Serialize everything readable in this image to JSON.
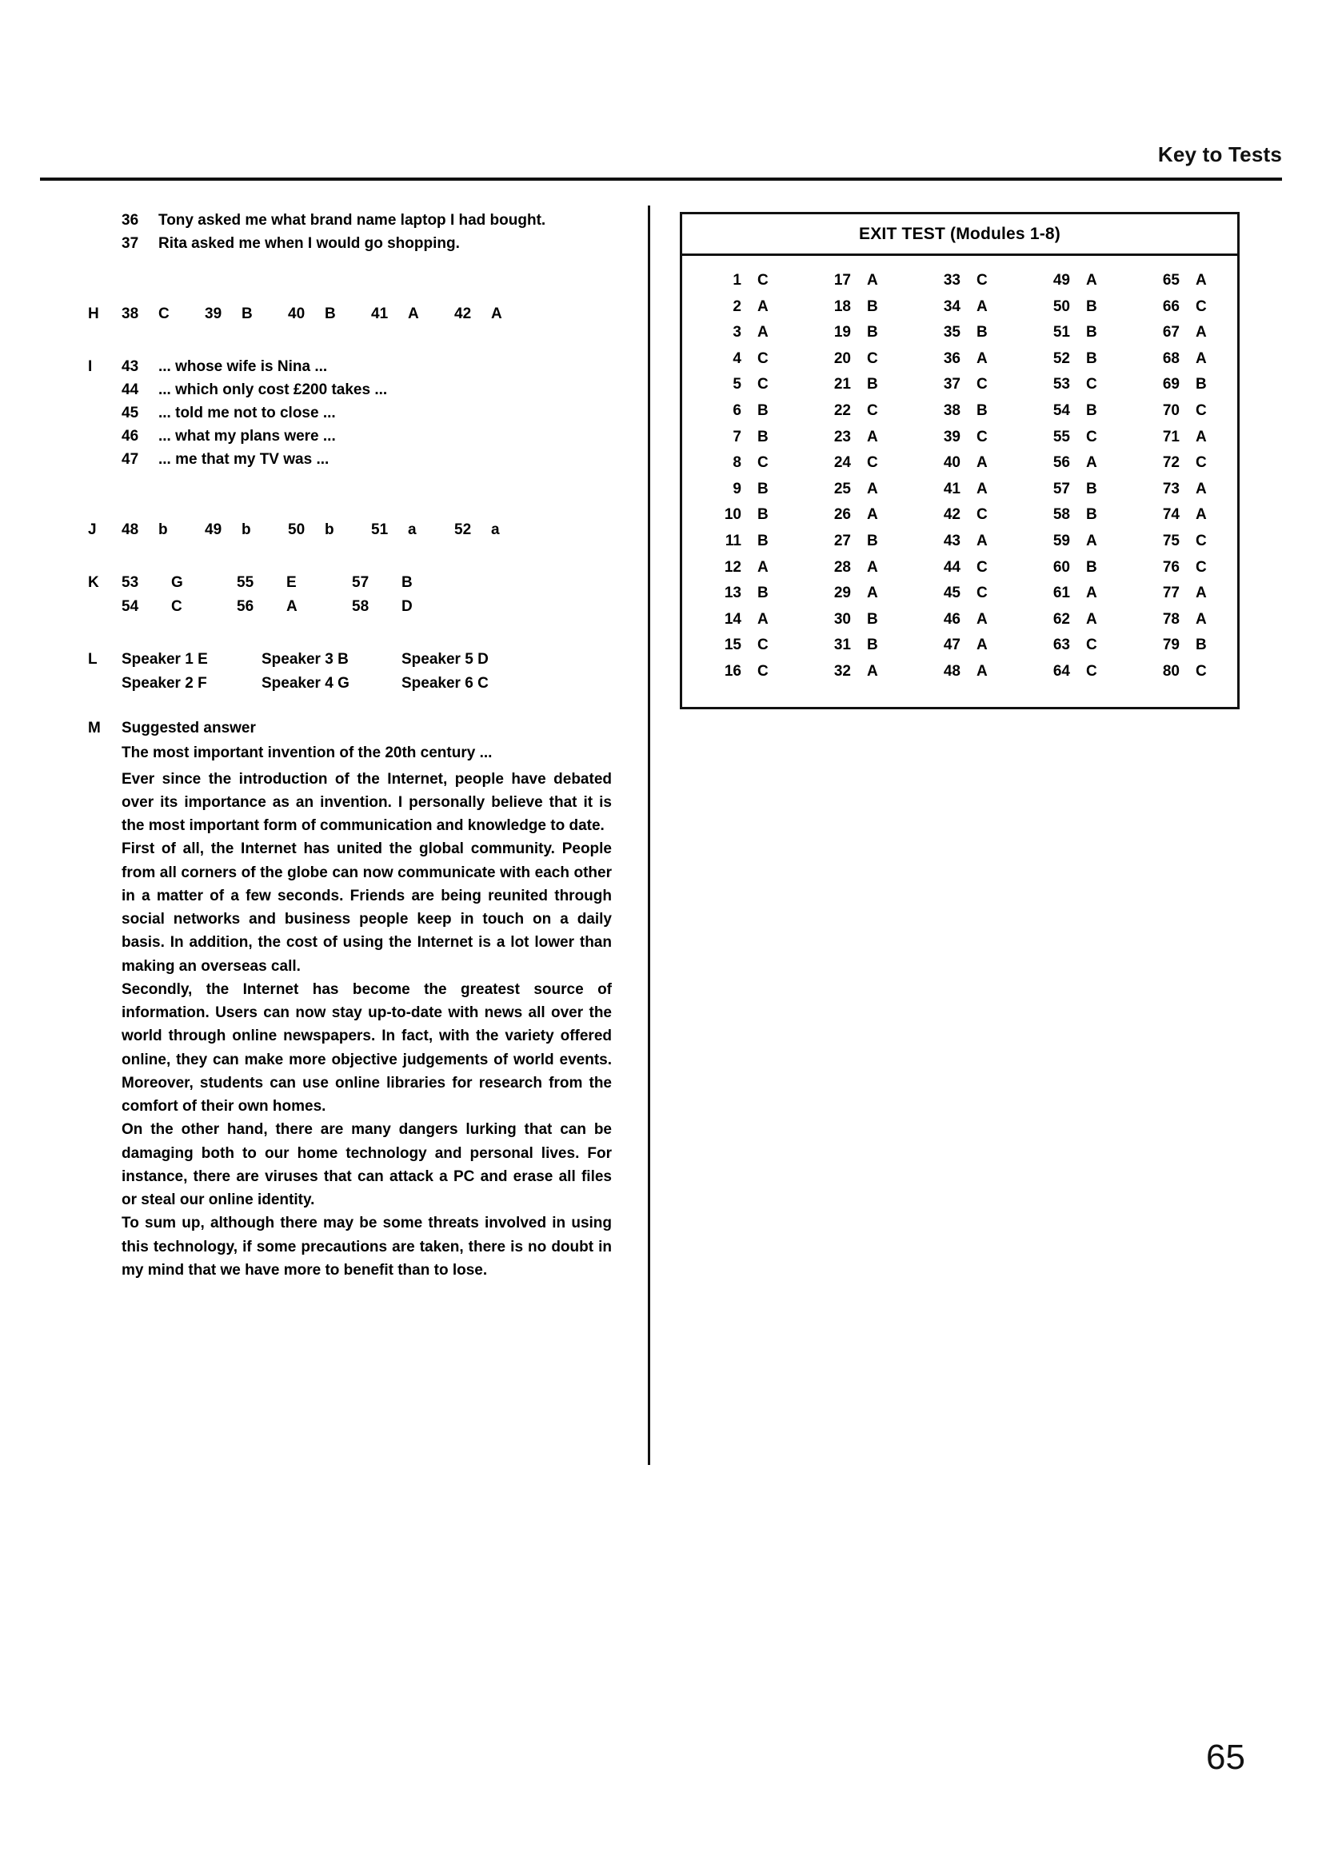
{
  "header": {
    "title": "Key to Tests"
  },
  "footer": {
    "page_number": "65"
  },
  "left_column": {
    "reported_speech": {
      "items": [
        {
          "num": "36",
          "text": "Tony asked me what brand name laptop I had bought."
        },
        {
          "num": "37",
          "text": "Rita asked me when I would go shopping."
        }
      ]
    },
    "section_h": {
      "letter": "H",
      "pairs": [
        {
          "q": "38",
          "a": "C"
        },
        {
          "q": "39",
          "a": "B"
        },
        {
          "q": "40",
          "a": "B"
        },
        {
          "q": "41",
          "a": "A"
        },
        {
          "q": "42",
          "a": "A"
        }
      ]
    },
    "section_i": {
      "letter": "I",
      "items": [
        {
          "num": "43",
          "text": "... whose wife is Nina ..."
        },
        {
          "num": "44",
          "text": "... which only cost £200 takes ..."
        },
        {
          "num": "45",
          "text": "... told me not to close ..."
        },
        {
          "num": "46",
          "text": "... what my plans were ..."
        },
        {
          "num": "47",
          "text": "... me that my TV was ..."
        }
      ]
    },
    "section_j": {
      "letter": "J",
      "pairs": [
        {
          "q": "48",
          "a": "b"
        },
        {
          "q": "49",
          "a": "b"
        },
        {
          "q": "50",
          "a": "b"
        },
        {
          "q": "51",
          "a": "a"
        },
        {
          "q": "52",
          "a": "a"
        }
      ]
    },
    "section_k": {
      "letter": "K",
      "rows": [
        [
          {
            "q": "53",
            "a": "G"
          },
          {
            "q": "55",
            "a": "E"
          },
          {
            "q": "57",
            "a": "B"
          }
        ],
        [
          {
            "q": "54",
            "a": "C"
          },
          {
            "q": "56",
            "a": "A"
          },
          {
            "q": "58",
            "a": "D"
          }
        ]
      ]
    },
    "section_l": {
      "letter": "L",
      "rows": [
        [
          "Speaker 1  E",
          "Speaker 3  B",
          "Speaker 5  D"
        ],
        [
          "Speaker 2  F",
          "Speaker 4  G",
          "Speaker 6  C"
        ]
      ]
    },
    "section_m": {
      "letter": "M",
      "heading": "Suggested answer",
      "title": "The most important invention of the 20th century ...",
      "paragraphs": [
        "Ever since the introduction of the Internet, people have debated over its importance as an invention. I personally believe that it is the most important form of communication and knowledge to date.",
        "First of all, the Internet has united the global community. People from all corners of the globe can now communicate with each other in a matter of a few seconds. Friends are being reunited through social networks and business people keep in touch on a daily basis. In addition, the cost of using the Internet is a lot lower than making an overseas call.",
        "Secondly, the Internet has become the greatest source of information. Users can now stay up-to-date with news all over the world through online newspapers. In fact, with the variety offered online, they can make more objective judgements of world events. Moreover, students can use online libraries for research from the comfort of their own homes.",
        "On the other hand, there are many dangers lurking that can be damaging both to our home technology and personal lives. For instance, there are viruses that can attack a PC and erase all files or steal our online identity.",
        "To sum up, although there may be some threats involved in using this technology, if some precautions are taken, there is no doubt in my mind that we have more to benefit than to lose."
      ]
    }
  },
  "exit_test": {
    "title": "EXIT TEST (Modules 1-8)",
    "columns": [
      [
        {
          "q": "1",
          "a": "C"
        },
        {
          "q": "2",
          "a": "A"
        },
        {
          "q": "3",
          "a": "A"
        },
        {
          "q": "4",
          "a": "C"
        },
        {
          "q": "5",
          "a": "C"
        },
        {
          "q": "6",
          "a": "B"
        },
        {
          "q": "7",
          "a": "B"
        },
        {
          "q": "8",
          "a": "C"
        },
        {
          "q": "9",
          "a": "B"
        },
        {
          "q": "10",
          "a": "B"
        },
        {
          "q": "11",
          "a": "B"
        },
        {
          "q": "12",
          "a": "A"
        },
        {
          "q": "13",
          "a": "B"
        },
        {
          "q": "14",
          "a": "A"
        },
        {
          "q": "15",
          "a": "C"
        },
        {
          "q": "16",
          "a": "C"
        }
      ],
      [
        {
          "q": "17",
          "a": "A"
        },
        {
          "q": "18",
          "a": "B"
        },
        {
          "q": "19",
          "a": "B"
        },
        {
          "q": "20",
          "a": "C"
        },
        {
          "q": "21",
          "a": "B"
        },
        {
          "q": "22",
          "a": "C"
        },
        {
          "q": "23",
          "a": "A"
        },
        {
          "q": "24",
          "a": "C"
        },
        {
          "q": "25",
          "a": "A"
        },
        {
          "q": "26",
          "a": "A"
        },
        {
          "q": "27",
          "a": "B"
        },
        {
          "q": "28",
          "a": "A"
        },
        {
          "q": "29",
          "a": "A"
        },
        {
          "q": "30",
          "a": "B"
        },
        {
          "q": "31",
          "a": "B"
        },
        {
          "q": "32",
          "a": "A"
        }
      ],
      [
        {
          "q": "33",
          "a": "C"
        },
        {
          "q": "34",
          "a": "A"
        },
        {
          "q": "35",
          "a": "B"
        },
        {
          "q": "36",
          "a": "A"
        },
        {
          "q": "37",
          "a": "C"
        },
        {
          "q": "38",
          "a": "B"
        },
        {
          "q": "39",
          "a": "C"
        },
        {
          "q": "40",
          "a": "A"
        },
        {
          "q": "41",
          "a": "A"
        },
        {
          "q": "42",
          "a": "C"
        },
        {
          "q": "43",
          "a": "A"
        },
        {
          "q": "44",
          "a": "C"
        },
        {
          "q": "45",
          "a": "C"
        },
        {
          "q": "46",
          "a": "A"
        },
        {
          "q": "47",
          "a": "A"
        },
        {
          "q": "48",
          "a": "A"
        }
      ],
      [
        {
          "q": "49",
          "a": "A"
        },
        {
          "q": "50",
          "a": "B"
        },
        {
          "q": "51",
          "a": "B"
        },
        {
          "q": "52",
          "a": "B"
        },
        {
          "q": "53",
          "a": "C"
        },
        {
          "q": "54",
          "a": "B"
        },
        {
          "q": "55",
          "a": "C"
        },
        {
          "q": "56",
          "a": "A"
        },
        {
          "q": "57",
          "a": "B"
        },
        {
          "q": "58",
          "a": "B"
        },
        {
          "q": "59",
          "a": "A"
        },
        {
          "q": "60",
          "a": "B"
        },
        {
          "q": "61",
          "a": "A"
        },
        {
          "q": "62",
          "a": "A"
        },
        {
          "q": "63",
          "a": "C"
        },
        {
          "q": "64",
          "a": "C"
        }
      ],
      [
        {
          "q": "65",
          "a": "A"
        },
        {
          "q": "66",
          "a": "C"
        },
        {
          "q": "67",
          "a": "A"
        },
        {
          "q": "68",
          "a": "A"
        },
        {
          "q": "69",
          "a": "B"
        },
        {
          "q": "70",
          "a": "C"
        },
        {
          "q": "71",
          "a": "A"
        },
        {
          "q": "72",
          "a": "C"
        },
        {
          "q": "73",
          "a": "A"
        },
        {
          "q": "74",
          "a": "A"
        },
        {
          "q": "75",
          "a": "C"
        },
        {
          "q": "76",
          "a": "C"
        },
        {
          "q": "77",
          "a": "A"
        },
        {
          "q": "78",
          "a": "A"
        },
        {
          "q": "79",
          "a": "B"
        },
        {
          "q": "80",
          "a": "C"
        }
      ]
    ]
  }
}
